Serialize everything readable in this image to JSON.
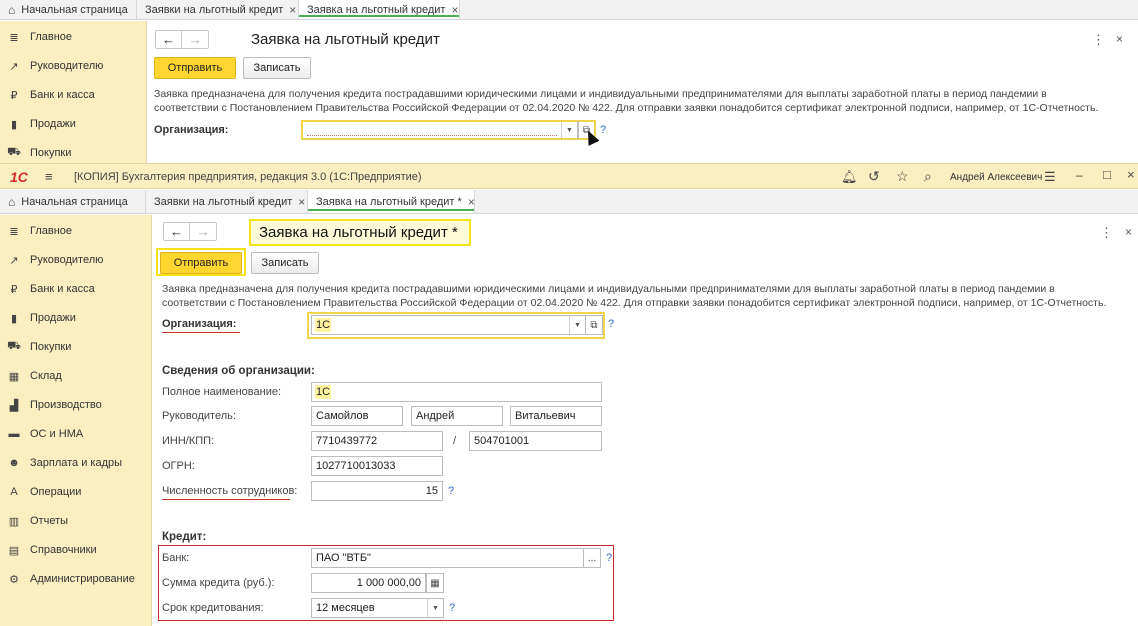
{
  "back_window": {
    "tabs": [
      {
        "label": "Начальная страница"
      },
      {
        "label": "Заявки на льготный кредит",
        "close": "×"
      },
      {
        "label": "Заявка на льготный кредит",
        "close": "×"
      }
    ],
    "sidebar": [
      {
        "icon": "≣",
        "label": "Главное"
      },
      {
        "icon": "↗",
        "label": "Руководителю"
      },
      {
        "icon": "₽",
        "label": "Банк и касса"
      },
      {
        "icon": "▮",
        "label": "Продажи"
      },
      {
        "icon": "⛟",
        "label": "Покупки"
      }
    ],
    "title": "Заявка на льготный кредит",
    "send_label": "Отправить",
    "save_label": "Записать",
    "description": "Заявка предназначена для получения кредита пострадавшими юридическими лицами и индивидуальными предпринимателями для выплаты заработной платы в период пандемии в соответствии с Постановлением Правительства Российской Федерации от 02.04.2020 № 422. Для отправки заявки понадобится сертификат электронной подписи, например, от 1С-Отчетность.",
    "org_label": "Организация:",
    "org_value": "",
    "help": "?",
    "menu": "⋮",
    "close": "×"
  },
  "titlebar": {
    "logo": "1С",
    "title": "[КОПИЯ] Бухгалтерия предприятия, редакция 3.0  (1С:Предприятие)",
    "user": "Андрей Алексеевич",
    "minimize": "–",
    "maximize": "□",
    "close": "×"
  },
  "front_window": {
    "tabs": [
      {
        "label": "Начальная страница"
      },
      {
        "label": "Заявки на льготный кредит",
        "close": "×"
      },
      {
        "label": "Заявка на льготный кредит *",
        "close": "×"
      }
    ],
    "sidebar": [
      {
        "icon": "≣",
        "label": "Главное"
      },
      {
        "icon": "↗",
        "label": "Руководителю"
      },
      {
        "icon": "₽",
        "label": "Банк и касса"
      },
      {
        "icon": "▮",
        "label": "Продажи"
      },
      {
        "icon": "⛟",
        "label": "Покупки"
      },
      {
        "icon": "▦",
        "label": "Склад"
      },
      {
        "icon": "▟",
        "label": "Производство"
      },
      {
        "icon": "▬",
        "label": "ОС и НМА"
      },
      {
        "icon": "☻",
        "label": "Зарплата и кадры"
      },
      {
        "icon": "A",
        "label": "Операции"
      },
      {
        "icon": "▥",
        "label": "Отчеты"
      },
      {
        "icon": "▤",
        "label": "Справочники"
      },
      {
        "icon": "⚙",
        "label": "Администрирование"
      }
    ],
    "title": "Заявка на льготный кредит *",
    "send_label": "Отправить",
    "save_label": "Записать",
    "description": "Заявка предназначена для получения кредита пострадавшими юридическими лицами и индивидуальными предпринимателями для выплаты заработной платы в период пандемии в соответствии с Постановлением Правительства Российской Федерации от 02.04.2020 № 422. Для отправки заявки понадобится сертификат электронной подписи, например, от 1С-Отчетность.",
    "org_label": "Организация:",
    "org_value": "1С",
    "org_section_title": "Сведения об организации:",
    "full_name_label": "Полное наименование:",
    "full_name_value": "1С",
    "head_label": "Руководитель:",
    "head_last": "Самойлов",
    "head_first": "Андрей",
    "head_middle": "Витальевич",
    "inn_label": "ИНН/КПП:",
    "inn_value": "7710439772",
    "slash": "/",
    "kpp_value": "504701001",
    "ogrn_label": "ОГРН:",
    "ogrn_value": "1027710013033",
    "staff_label": "Численность сотрудников:",
    "staff_value": "15",
    "credit_section_title": "Кредит:",
    "bank_label": "Банк:",
    "bank_value": "ПАО \"ВТБ\"",
    "bank_select": "...",
    "amount_label": "Сумма кредита (руб.):",
    "amount_value": "1 000 000,00",
    "term_label": "Срок кредитования:",
    "term_value": "12 месяцев",
    "help": "?",
    "menu": "⋮",
    "close": "×"
  }
}
